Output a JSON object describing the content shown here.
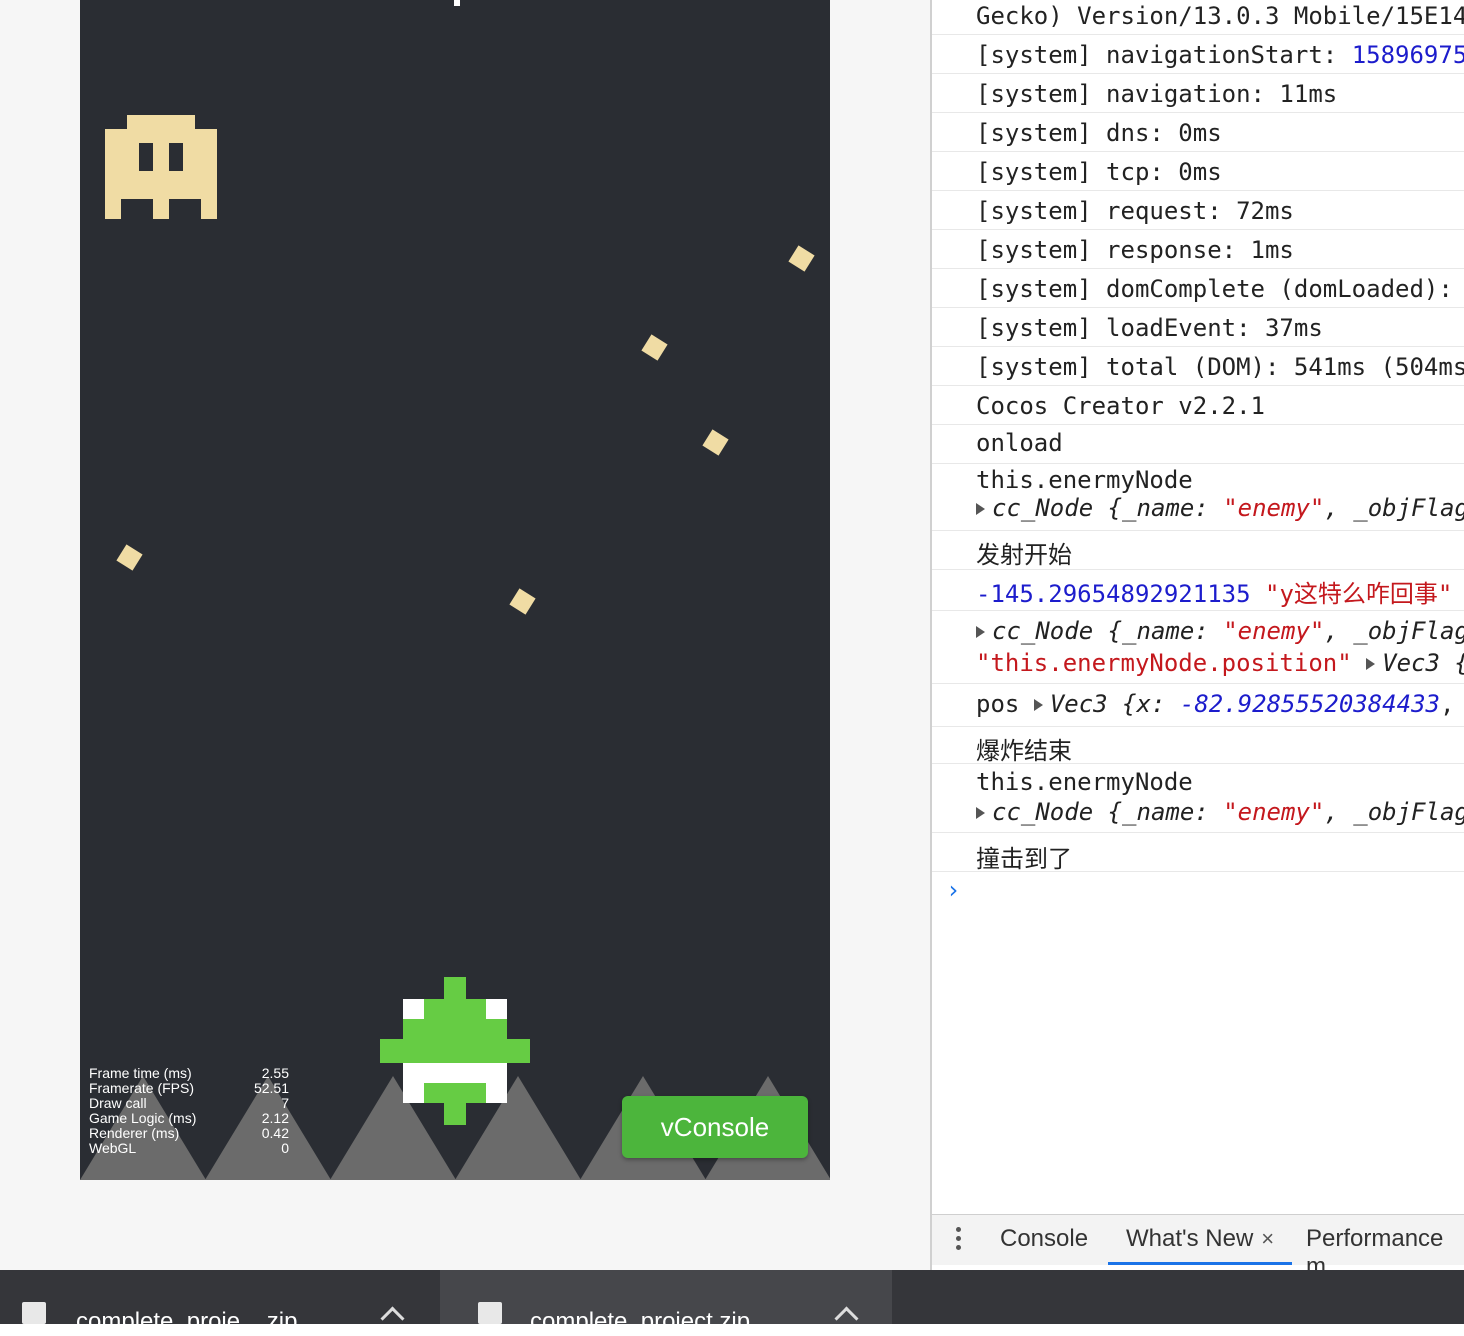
{
  "game": {
    "stats": [
      {
        "label": "Frame time (ms)",
        "value": "2.55"
      },
      {
        "label": "Framerate (FPS)",
        "value": "52.51"
      },
      {
        "label": "Draw call",
        "value": "7"
      },
      {
        "label": "Game Logic (ms)",
        "value": "2.12"
      },
      {
        "label": "Renderer (ms)",
        "value": "0.42"
      },
      {
        "label": "WebGL",
        "value": "0"
      }
    ],
    "vconsole_label": "vConsole",
    "colors": {
      "background": "#2a2d33",
      "enemy": "#f0dca4",
      "player": "#66cc44",
      "mountain": "#6b6b6b",
      "vconsole": "#4cb53c"
    }
  },
  "console": {
    "logs": {
      "ua": "Gecko) Version/13.0.3 Mobile/15E14",
      "nav_start_label": "[system] navigationStart: ",
      "nav_start_value": "15896975",
      "navigation": "[system] navigation: 11ms",
      "dns": "[system] dns: 0ms",
      "tcp": "[system] tcp: 0ms",
      "request": "[system] request: 72ms",
      "response": "[system] response: 1ms",
      "dom_complete": "[system] domComplete (domLoaded):",
      "load_event": "[system] loadEvent: 37ms",
      "total": "[system] total (DOM): 541ms (504ms",
      "cocos": "Cocos Creator v2.2.1",
      "onload": "onload",
      "enemy_node_1": "this.enermyNode",
      "cc_node_type": "cc_Node {",
      "name_key": "_name:",
      "name_value": "\"enemy\"",
      "objflag": ", _objFlag",
      "fire_start": "发射开始",
      "y_value": "-145.29654892921135",
      "y_string": "\"y这特么咋回事\"",
      "position_string": "\"this.enermyNode.position\"",
      "vec3": "Vec3",
      "vec3_tail": "{",
      "pos_label": "pos",
      "pos_vec3": "Vec3 {",
      "x_key": "x:",
      "x_value": "-82.92855520384433",
      "comma": ",",
      "explode_end": "爆炸结束",
      "enemy_node_2": "this.enermyNode",
      "hit": "撞击到了"
    },
    "prompt": "›"
  },
  "drawer": {
    "tabs": [
      "Console",
      "What's New",
      "Performance m"
    ],
    "close_glyph": "×"
  },
  "downloads": [
    {
      "name": "complete_proje....zip"
    },
    {
      "name": "complete_project.zip"
    }
  ]
}
